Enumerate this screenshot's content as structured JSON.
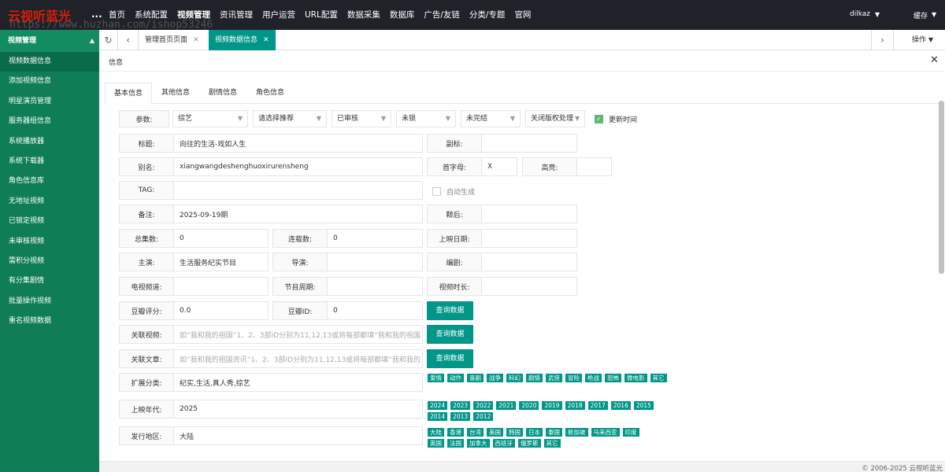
{
  "brand": "云视听蓝光",
  "watermark": "https://www.huzhan.com/ishop53246",
  "nav": {
    "more": "...",
    "items": [
      "首页",
      "系统配置",
      "视频管理",
      "资讯管理",
      "用户运营",
      "URL配置",
      "数据采集",
      "数据库",
      "广告/友链",
      "分类/专题",
      "官网"
    ],
    "active_index": 2,
    "user": "dilkaz",
    "cache": "缓存"
  },
  "sidebar": {
    "title": "视频管理",
    "items": [
      "视频数据信息",
      "添加视频信息",
      "明星演员管理",
      "服务器组信息",
      "系统播放器",
      "系统下载器",
      "角色信息库",
      "无地址视频",
      "已锁定视频",
      "未审核视频",
      "需积分视频",
      "有分集剧情",
      "批量操作视频",
      "重名视频数据"
    ],
    "active_index": 0
  },
  "tabs": {
    "home": "管理首页页面",
    "current": "视频数据信息",
    "operations": "操作"
  },
  "card": {
    "title": "信息"
  },
  "form_tabs": [
    "基本信息",
    "其他信息",
    "剧情信息",
    "角色信息"
  ],
  "form": {
    "params_label": "参数:",
    "category": "综艺",
    "recommend": "请选择推荐",
    "audit": "已审核",
    "lock": "未锁",
    "finish": "未完结",
    "copyright": "关闭版权处理",
    "update_time": "更新时间",
    "title_label": "标题:",
    "title_value": "向往的生活-戏如人生",
    "subtitle_label": "副标:",
    "alias_label": "别名:",
    "alias_value": "xiangwangdeshenghuoxirurensheng",
    "initial_label": "首字母:",
    "initial_value": "X",
    "highlight_label": "高亮:",
    "tag_label": "TAG:",
    "auto_gen": "自动生成",
    "remark_label": "备注:",
    "remark_value": "2025-09-19期",
    "afterward_label": "鞥后:",
    "total_label": "总集数:",
    "total_value": "0",
    "serial_label": "连载数:",
    "serial_value": "0",
    "release_date_label": "上映日期:",
    "actor_label": "主演:",
    "actor_value": "生活服务纪实节目",
    "director_label": "导演:",
    "writer_label": "编剧:",
    "tv_label": "电视频道:",
    "period_label": "节目周期:",
    "duration_label": "视频时长:",
    "douban_score_label": "豆瓣评分:",
    "douban_score_value": "0.0",
    "douban_id_label": "豆瓣ID:",
    "douban_id_value": "0",
    "query_button": "查询数据",
    "related_video_label": "关联视频:",
    "related_video_placeholder": "如“我和我的祖国”1、2、3部ID分别为11,12,13或将每部都填“我和我的祖国",
    "related_article_label": "关联文章:",
    "related_article_placeholder": "如“我和我的祖国资讯”1、2、3部ID分别为11,12,13或将每部都填“我和我的",
    "ext_category_label": "扩展分类:",
    "ext_category_value": "纪实,生活,真人秀,综艺",
    "year_label": "上映年代:",
    "year_value": "2025",
    "region_label": "发行地区:",
    "region_value": "大陆"
  },
  "genre_tags": [
    "爱情",
    "动作",
    "喜剧",
    "战争",
    "科幻",
    "剧情",
    "武侠",
    "冒险",
    "枪战",
    "恐怖",
    "微电影",
    "其它"
  ],
  "year_tags": [
    "2024",
    "2023",
    "2022",
    "2021",
    "2020",
    "2019",
    "2018",
    "2017",
    "2016",
    "2015",
    "2014",
    "2013",
    "2012"
  ],
  "region_tags": [
    "大陆",
    "香港",
    "台湾",
    "美国",
    "韩国",
    "日本",
    "泰国",
    "新加坡",
    "马来西亚",
    "印度",
    "英国",
    "法国",
    "加拿大",
    "西班牙",
    "俄罗斯",
    "其它"
  ],
  "footer": "© 2006-2025 云视听蓝光",
  "colors": {
    "topbar": "#20222a",
    "sidebar": "#0f7e57",
    "accent": "#009688",
    "brand": "#d81e06"
  }
}
